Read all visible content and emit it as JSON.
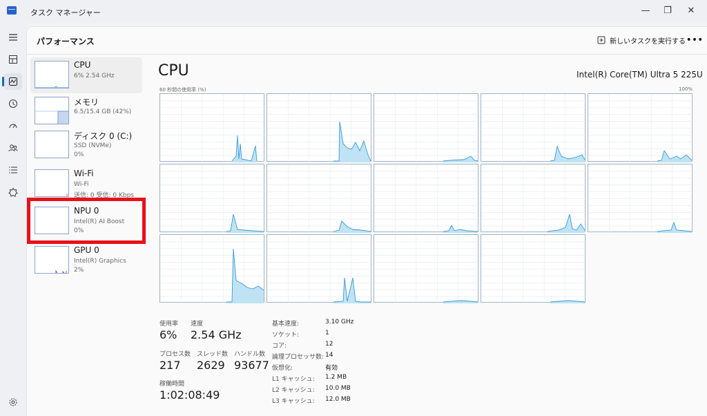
{
  "window": {
    "title": "タスク マネージャー",
    "buttons": {
      "minimize": "—",
      "restore": "❐",
      "close": "✕"
    }
  },
  "nav_icons": [
    "hamburger-icon",
    "processes-icon",
    "performance-icon",
    "history-icon",
    "startup-icon",
    "users-icon",
    "details-icon",
    "services-icon",
    "settings-icon"
  ],
  "header": {
    "title": "パフォーマンス",
    "run_task": "新しいタスクを実行する",
    "more": "•••"
  },
  "sidebar": {
    "items": [
      {
        "name": "CPU",
        "lines": [
          "6% 2.54 GHz"
        ]
      },
      {
        "name": "メモリ",
        "lines": [
          "6.5/15.4 GB (42%)"
        ]
      },
      {
        "name": "ディスク 0 (C:)",
        "lines": [
          "SSD (NVMe)",
          "0%"
        ]
      },
      {
        "name": "Wi-Fi",
        "lines": [
          "Wi-Fi",
          "送信: 0 受信: 0 Kbps"
        ]
      },
      {
        "name": "NPU 0",
        "lines": [
          "Intel(R) AI Boost",
          "0%"
        ]
      },
      {
        "name": "GPU 0",
        "lines": [
          "Intel(R) Graphics",
          "2%"
        ]
      }
    ]
  },
  "cpu": {
    "title": "CPU",
    "model": "Intel(R) Core(TM) Ultra 5 225U",
    "chart_label": "60 秒間の使用率 (%)",
    "chart_max": "100%",
    "core_count": 14
  },
  "stats": {
    "utilization_label": "使用率",
    "utilization": "6%",
    "speed_label": "速度",
    "speed": "2.54 GHz",
    "processes_label": "プロセス数",
    "processes": "217",
    "threads_label": "スレッド数",
    "threads": "2629",
    "handles_label": "ハンドル数",
    "handles": "93677",
    "uptime_label": "稼働時間",
    "uptime": "1:02:08:49"
  },
  "specs": [
    {
      "key": "基本速度:",
      "value": "3.10 GHz"
    },
    {
      "key": "ソケット:",
      "value": "1"
    },
    {
      "key": "コア:",
      "value": "12"
    },
    {
      "key": "論理プロセッサ数:",
      "value": "14"
    },
    {
      "key": "仮想化:",
      "value": "有効"
    },
    {
      "key": "L1 キャッシュ:",
      "value": "1.2 MB"
    },
    {
      "key": "L2 キャッシュ:",
      "value": "10.0 MB"
    },
    {
      "key": "L3 キャッシュ:",
      "value": "12.0 MB"
    }
  ],
  "colors": {
    "accent": "#0f6cbd",
    "cpu_line": "#3a9ad4",
    "cpu_fill": "#bfe3f4",
    "highlight": "#e8101a",
    "grid": "#e4e8ee"
  }
}
